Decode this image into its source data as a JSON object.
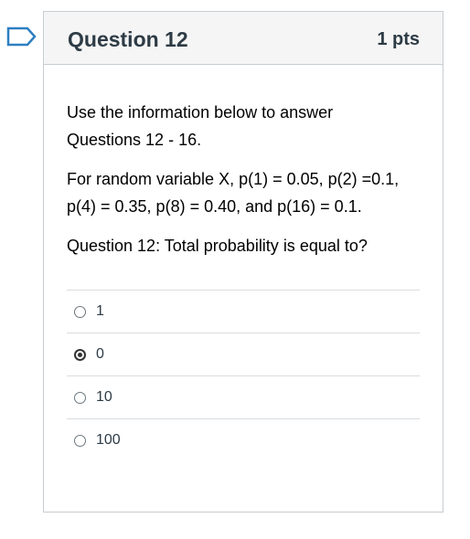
{
  "question": {
    "title": "Question 12",
    "points": "1 pts",
    "paragraphs": [
      "Use the information below to answer Questions 12 - 16.",
      "For random variable X, p(1) = 0.05, p(2) =0.1, p(4) = 0.35, p(8) = 0.40, and p(16) = 0.1.",
      "Question 12: Total probability is equal to?"
    ],
    "options": [
      {
        "label": "1",
        "selected": false
      },
      {
        "label": "0",
        "selected": true
      },
      {
        "label": "10",
        "selected": false
      },
      {
        "label": "100",
        "selected": false
      }
    ]
  },
  "flag_icon": "bookmark-flag-icon",
  "colors": {
    "flag": "#2d7fc1",
    "border": "#c7cdd1",
    "header_bg": "#f5f5f5"
  }
}
